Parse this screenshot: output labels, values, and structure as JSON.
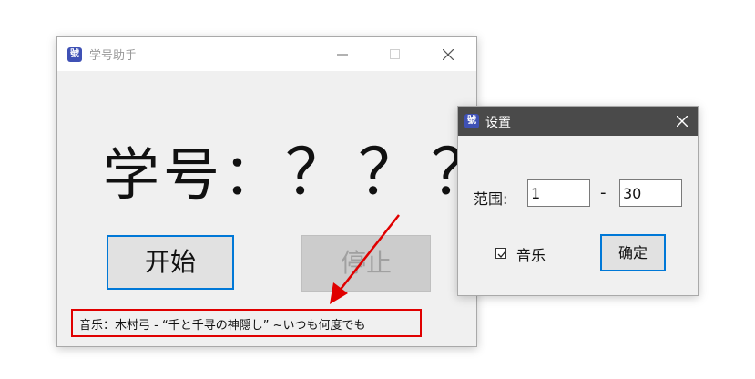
{
  "main_window": {
    "title": "学号助手",
    "icon_text": "號",
    "student_label": "学号：",
    "student_value": "？？？",
    "start_button": "开始",
    "stop_button": "停止",
    "music_info": "音乐：木村弓 - “千と千寻の神隠し” ~いつも何度でも"
  },
  "settings_window": {
    "title": "设置",
    "icon_text": "號",
    "range_label": "范围:",
    "range_from": "1",
    "range_dash": "-",
    "range_to": "30",
    "music_checkbox_label": "音乐",
    "music_checked": true,
    "ok_button": "确定"
  },
  "colors": {
    "accent": "#0078d7",
    "highlight_red": "#e00000",
    "settings_titlebar": "#4a4a4a"
  },
  "icons": [
    "minimize-icon",
    "maximize-icon",
    "close-icon",
    "app-icon",
    "checkmark-icon",
    "annotation-arrow"
  ]
}
